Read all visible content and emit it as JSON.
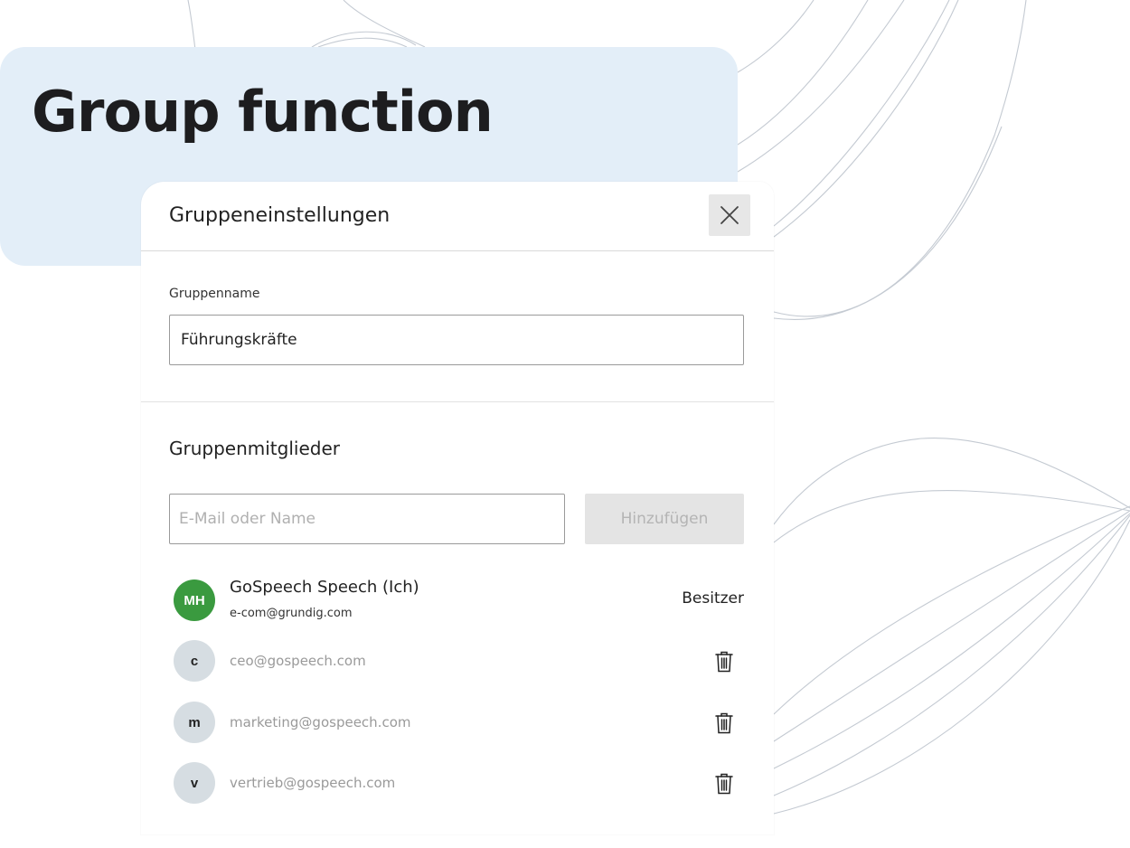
{
  "hero": {
    "title": "Group function",
    "panel_color": "#e3eef8"
  },
  "dialog": {
    "title": "Gruppeneinstellungen",
    "close_icon": "close-icon",
    "group_name_label": "Gruppenname",
    "group_name_value": "Führungskräfte",
    "members_heading": "Gruppenmitglieder",
    "member_input_placeholder": "E-Mail oder Name",
    "add_button_label": "Hinzufügen",
    "owner": {
      "initials": "MH",
      "name": "GoSpeech Speech (Ich)",
      "email": "e-com@grundig.com",
      "role": "Besitzer",
      "avatar_color": "#3a9a3f"
    },
    "members": [
      {
        "initial": "c",
        "email": "ceo@gospeech.com",
        "action_icon": "trash-icon"
      },
      {
        "initial": "m",
        "email": "marketing@gospeech.com",
        "action_icon": "trash-icon"
      },
      {
        "initial": "v",
        "email": "vertrieb@gospeech.com",
        "action_icon": "trash-icon"
      }
    ],
    "member_avatar_color": "#d6dde2",
    "disabled_button_color": "#e4e4e4"
  }
}
